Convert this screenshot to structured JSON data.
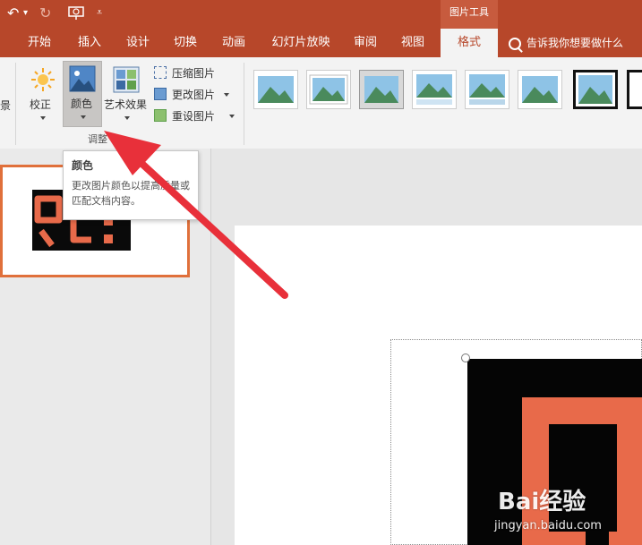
{
  "colors": {
    "accent": "#b7472a",
    "context_tab": "#c75b3e",
    "ribbon_bg": "#f3f3f3",
    "arrow": "#e8303a",
    "selection_border": "#e0703b"
  },
  "titlebar": {
    "context_group": "图片工具",
    "quick_access": [
      "undo-icon",
      "redo-icon",
      "present-icon",
      "customize-icon"
    ]
  },
  "tabs": [
    {
      "label": "开始"
    },
    {
      "label": "插入"
    },
    {
      "label": "设计"
    },
    {
      "label": "切换"
    },
    {
      "label": "动画"
    },
    {
      "label": "幻灯片放映"
    },
    {
      "label": "审阅"
    },
    {
      "label": "视图"
    },
    {
      "label": "格式",
      "active": true
    }
  ],
  "tell_me": "告诉我你想要做什么",
  "ribbon": {
    "cut_off_label": "景",
    "correct_label": "校正",
    "color_label": "颜色",
    "artistic_label": "艺术效果",
    "compress_label": "压缩图片",
    "change_label": "更改图片",
    "reset_label": "重设图片",
    "group_label": "调整"
  },
  "tooltip": {
    "title": "颜色",
    "body": "更改图片颜色以提高质量或匹配文档内容。"
  },
  "watermark": {
    "logo": "Bai经验",
    "url": "jingyan.baidu.com"
  }
}
